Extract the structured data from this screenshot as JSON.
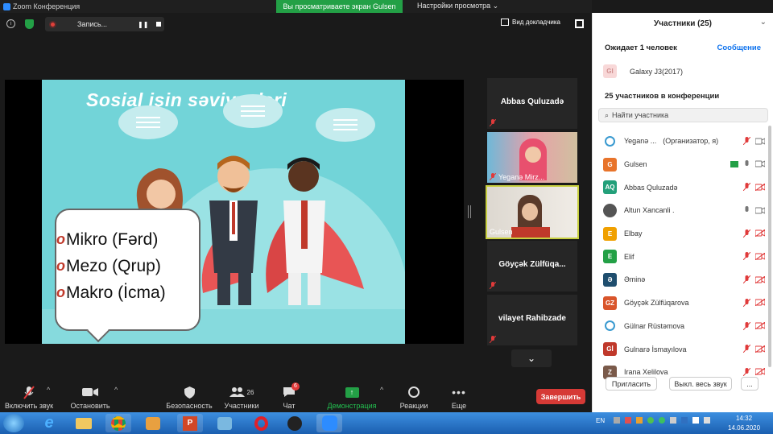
{
  "window": {
    "title": "Zoom Конференция"
  },
  "banner": {
    "text": "Вы просматриваете экран Gulsen",
    "view_options": "Настройки просмотра"
  },
  "recording": {
    "label": "Запись..."
  },
  "top_right": {
    "speaker_view": "Вид докладчика"
  },
  "slide": {
    "title": "Sosial işin səviyyələri",
    "bullet_mark": "o",
    "levels": [
      "Mikro (Fərd)",
      "Mezo (Qrup)",
      "Makro (İcma)"
    ]
  },
  "tiles": [
    {
      "name": "Abbas Quluzadə",
      "type": "name"
    },
    {
      "name": "Yeganə Mirz...",
      "type": "video"
    },
    {
      "name": "Gulsen",
      "type": "video"
    },
    {
      "name": "Göyçək Zülfüqa...",
      "type": "name"
    },
    {
      "name": "vilayet Rahibzade",
      "type": "name"
    }
  ],
  "toolbar": {
    "audio": "Включить звук",
    "video": "Остановить видео",
    "security": "Безопасность",
    "participants": "Участники",
    "participants_count": "26",
    "chat": "Чат",
    "chat_badge": "6",
    "share": "Демонстрация экрана",
    "reactions": "Реакции",
    "more": "Еще",
    "end": "Завершить"
  },
  "panel": {
    "title": "Участники (25)",
    "waiting": "Ожидает 1 человек",
    "message": "Сообщение",
    "waiting_user": {
      "initials": "GI",
      "name": "Galaxy J3(2017)"
    },
    "in_conf": "25 участников в конференции",
    "search_placeholder": "Найти участника",
    "participants": [
      {
        "initials": "",
        "name": "Yeganə ...",
        "extra": "(Организатор, я)",
        "color": "#ffffff",
        "logo": true
      },
      {
        "initials": "G",
        "name": "Gulsen",
        "color": "#e8742b"
      },
      {
        "initials": "AQ",
        "name": "Abbas Quluzadə",
        "color": "#23a07a"
      },
      {
        "initials": "",
        "name": "Altun Xancanli .",
        "color": "#555555",
        "photo": true
      },
      {
        "initials": "E",
        "name": "Elbay",
        "color": "#f0a000"
      },
      {
        "initials": "E",
        "name": "Elif",
        "color": "#23a046"
      },
      {
        "initials": "Ə",
        "name": "Əminə",
        "color": "#1f4e6e"
      },
      {
        "initials": "GZ",
        "name": "Göyçək Zülfüqarova",
        "color": "#d9552b"
      },
      {
        "initials": "",
        "name": "Gülnar Rüstəmova",
        "color": "#ffffff",
        "logo": true
      },
      {
        "initials": "Gİ",
        "name": "Gulnarə İsmayılova",
        "color": "#c0392b"
      },
      {
        "initials": "Z",
        "name": "Irana Xelilova",
        "color": "#7a5a4a"
      }
    ],
    "invite": "Пригласить",
    "mute_all": "Выкл. весь звук",
    "more": "..."
  },
  "taskbar": {
    "lang": "EN",
    "time": "14:32",
    "date": "14.06.2020"
  }
}
